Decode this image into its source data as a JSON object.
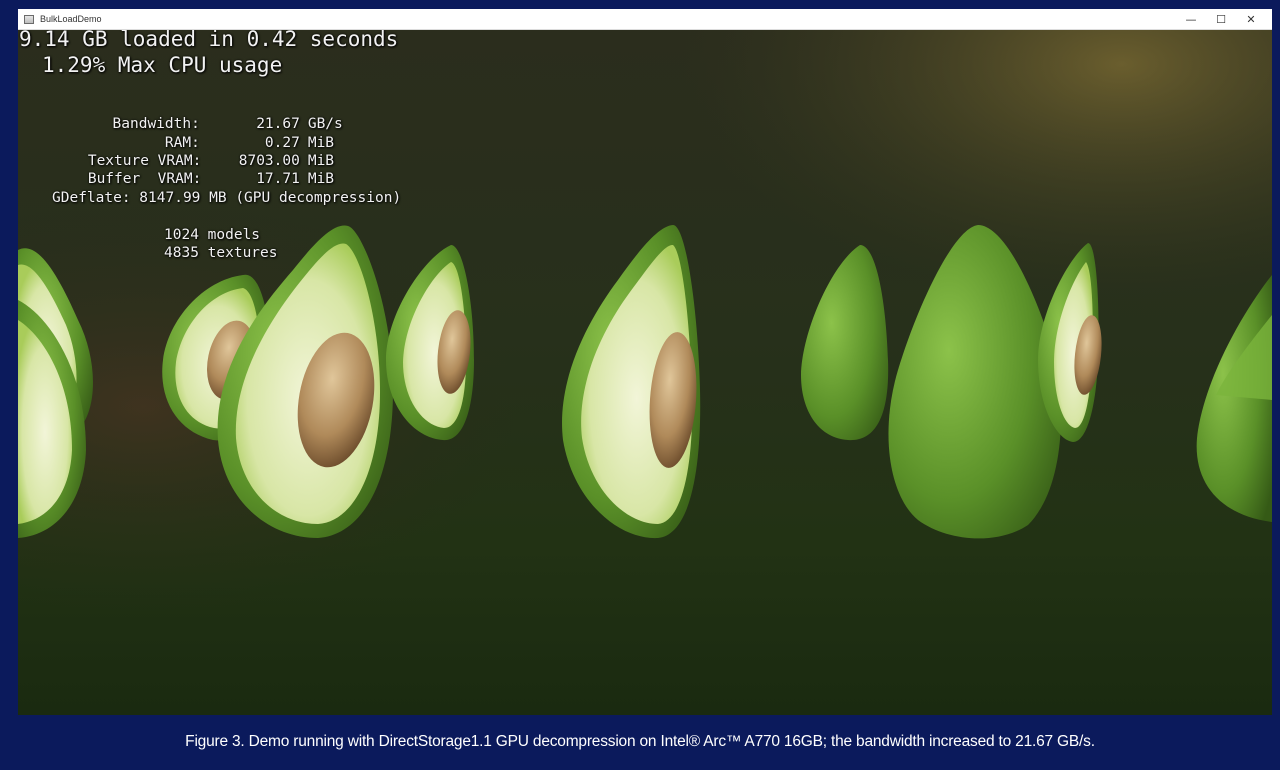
{
  "window": {
    "title": "BulkLoadDemo",
    "controls": {
      "minimize": "—",
      "maximize": "☐",
      "close": "✕"
    }
  },
  "hud": {
    "line1": "9.14 GB loaded in 0.42 seconds",
    "line2": "1.29% Max CPU usage",
    "stats": [
      {
        "label": "Bandwidth:",
        "value": "21.67",
        "unit": "GB/s"
      },
      {
        "label": "RAM:",
        "value": "0.27",
        "unit": "MiB"
      },
      {
        "label": "Texture VRAM:",
        "value": "8703.00",
        "unit": "MiB"
      },
      {
        "label": "Buffer  VRAM:",
        "value": "17.71",
        "unit": "MiB"
      }
    ],
    "gdeflate": "GDeflate: 8147.99 MB (GPU decompression)",
    "models": "1024 models",
    "textures": "4835 textures"
  },
  "caption": "Figure 3. Demo running with DirectStorage1.1 GPU decompression on Intel® Arc™ A770 16GB; the bandwidth increased to 21.67 GB/s.",
  "colors": {
    "page_bg": "#0b1a5c",
    "avocado_skin": "#5f9a2a",
    "avocado_flesh": "#e2ecbd",
    "avocado_pit": "#b99a6a"
  }
}
